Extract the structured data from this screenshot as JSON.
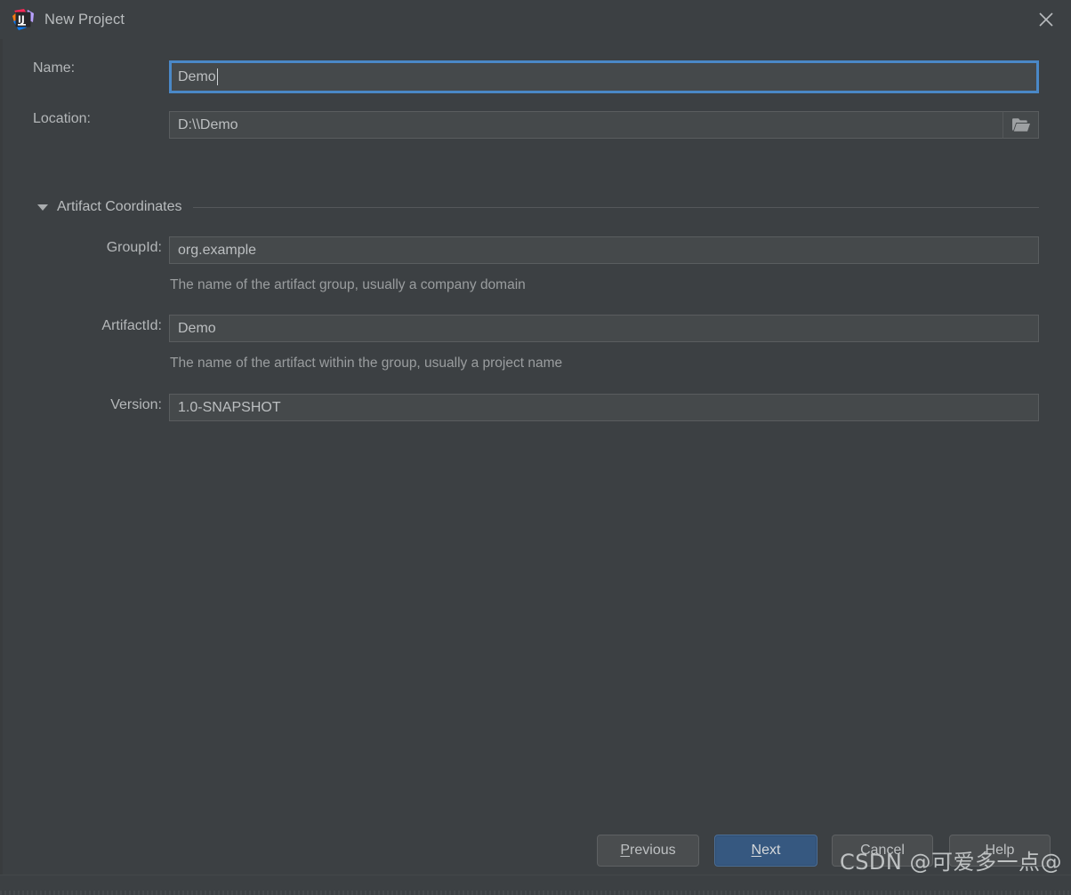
{
  "window": {
    "title": "New Project",
    "logo_icon": "intellij-idea-logo",
    "close_icon": "close-icon"
  },
  "form": {
    "name": {
      "label": "Name:",
      "value": "Demo",
      "focused": true
    },
    "location": {
      "label": "Location:",
      "value": "D:\\\\Demo",
      "browse_icon": "folder-open-icon"
    }
  },
  "artifact_section": {
    "title": "Artifact Coordinates",
    "expanded": true,
    "collapse_icon": "triangle-down-icon",
    "fields": [
      {
        "label": "GroupId:",
        "value": "org.example",
        "hint": "The name of the artifact group, usually a company domain"
      },
      {
        "label": "ArtifactId:",
        "value": "Demo",
        "hint": "The name of the artifact within the group, usually a project name"
      },
      {
        "label": "Version:",
        "value": "1.0-SNAPSHOT",
        "hint": ""
      }
    ]
  },
  "footer": {
    "buttons": [
      {
        "label": "Previous",
        "mnemonic": "P",
        "rest": "revious",
        "primary": false
      },
      {
        "label": "Next",
        "mnemonic": "N",
        "rest": "ext",
        "primary": true
      },
      {
        "label": "Cancel",
        "mnemonic": "",
        "rest": "Cancel",
        "primary": false
      },
      {
        "label": "Help",
        "mnemonic": "",
        "rest": "Help",
        "primary": false
      }
    ]
  },
  "watermark": {
    "text": "CSDN @可爱多一点@"
  },
  "colors": {
    "background": "#3c4043",
    "field_background": "#45494b",
    "field_border": "#5a5d5f",
    "focus_blue": "#4a88c7",
    "primary_button": "#365880",
    "text": "#b4b7b9",
    "hint_text": "#9a9d9f"
  }
}
